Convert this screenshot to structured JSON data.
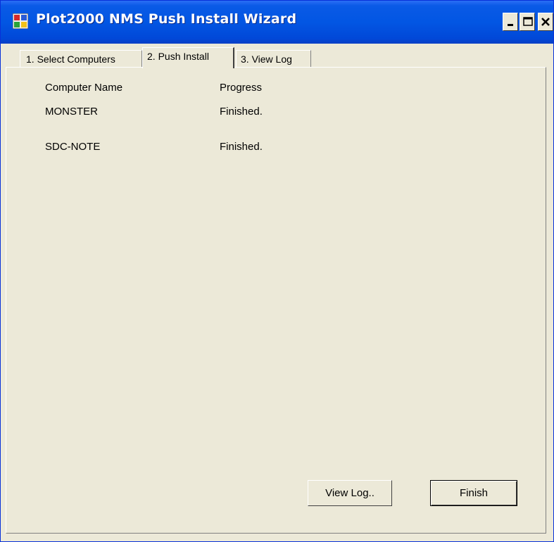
{
  "window": {
    "title": "Plot2000 NMS Push Install Wizard",
    "controls": {
      "minimize": "minimize-icon",
      "maximize": "maximize-icon",
      "close": "close-icon"
    }
  },
  "tabs": [
    {
      "label": "1. Select Computers",
      "selected": false
    },
    {
      "label": "2. Push Install",
      "selected": true
    },
    {
      "label": "3. View Log",
      "selected": false
    }
  ],
  "table": {
    "headers": [
      "Computer Name",
      "Progress"
    ],
    "rows": [
      {
        "computer": "MONSTER",
        "progress": "Finished."
      },
      {
        "computer": "SDC-NOTE",
        "progress": "Finished."
      }
    ]
  },
  "buttons": {
    "view_log": "View Log..",
    "finish": "Finish"
  },
  "colors": {
    "titlebar": "#0256e3",
    "face": "#ece9d8"
  }
}
